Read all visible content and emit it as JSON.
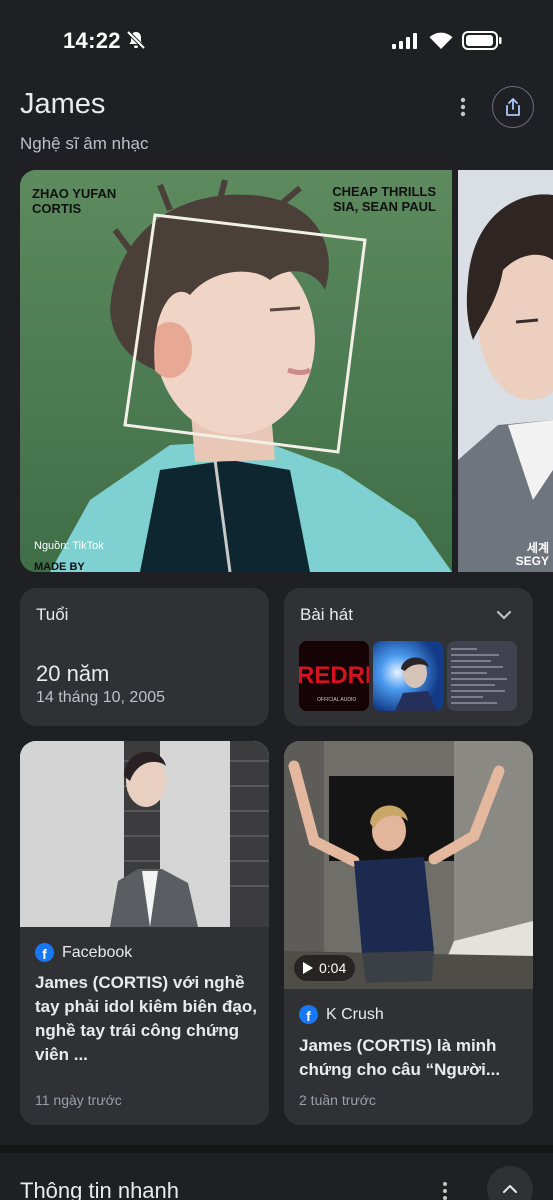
{
  "status_bar": {
    "time": "14:22",
    "icons": [
      "bell-off-icon",
      "signal-icon",
      "wifi-icon",
      "battery-icon"
    ]
  },
  "header": {
    "title": "James",
    "subtitle": "Nghệ sĩ âm nhạc",
    "more_icon": "more-vert-icon",
    "share_icon": "share-icon"
  },
  "images": {
    "main": {
      "text_left": [
        "ZHAO YUFAN",
        "CORTIS"
      ],
      "text_right": [
        "CHEAP THRILLS",
        "SIA, SEAN PAUL"
      ],
      "source": "Nguồn: TikTok",
      "made_by": "MADE BY"
    },
    "second": {
      "corner_text": [
        "세계",
        "SEGY"
      ]
    }
  },
  "age_card": {
    "label": "Tuổi",
    "value": "20 năm",
    "date": "14 tháng 10, 2005"
  },
  "songs_card": {
    "label": "Bài hát",
    "chevron_icon": "chevron-down-icon",
    "thumbnails": [
      {
        "name": "song-thumb-redred",
        "text": "REDRE",
        "caption": "OFFICIAL AUDIO"
      },
      {
        "name": "song-thumb-blue"
      },
      {
        "name": "song-thumb-tracklist"
      }
    ]
  },
  "news": [
    {
      "source": "Facebook",
      "title": "James (CORTIS) với nghề tay phải idol kiêm biên đạo, nghề tay trái công chứng viên ...",
      "time": "11 ngày trước"
    },
    {
      "source": "K Crush",
      "duration": "0:04",
      "title": "James (CORTIS) là minh chứng cho câu “Người...",
      "time": "2 tuần trước"
    }
  ],
  "quick_info": {
    "title": "Thông tin nhanh",
    "more_icon": "more-vert-icon",
    "expand_icon": "chevron-up-icon"
  },
  "colors": {
    "background": "#1f2023",
    "card": "#303134",
    "text_primary": "#e8eaed",
    "text_secondary": "#9aa0a6",
    "facebook_blue": "#1877f2"
  }
}
